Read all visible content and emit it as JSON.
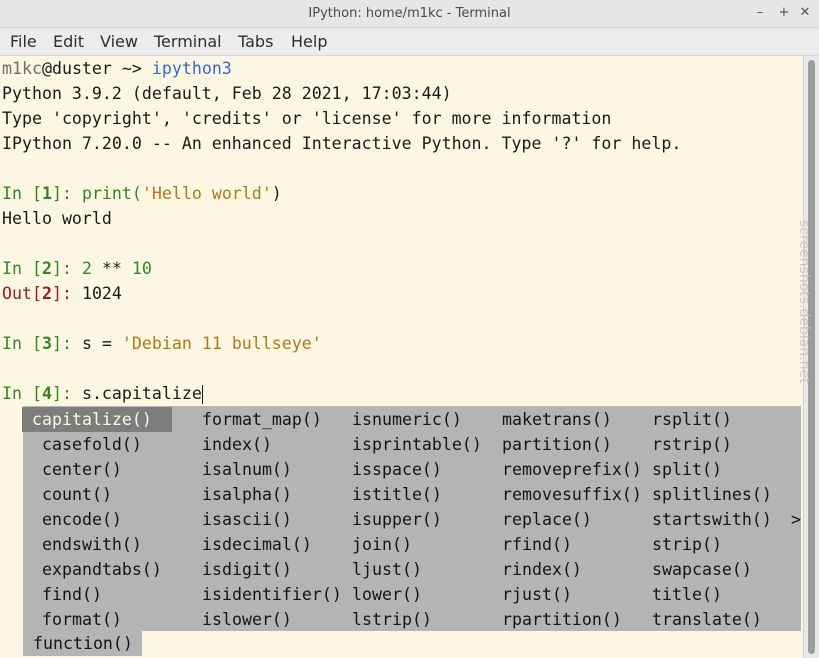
{
  "window": {
    "title": "IPython: home/m1kc - Terminal",
    "min_glyph": "–",
    "max_glyph": "+",
    "close_glyph": "✕"
  },
  "menu": [
    "File",
    "Edit",
    "View",
    "Terminal",
    "Tabs",
    "Help"
  ],
  "terminal": {
    "prompt_user": "m1kc",
    "prompt_host": "@duster ~>",
    "prompt_cmd": "ipython3",
    "banner": [
      "Python 3.9.2 (default, Feb 28 2021, 17:03:44)",
      "Type 'copyright', 'credits' or 'license' for more information",
      "IPython 7.20.0 -- An enhanced Interactive Python. Type '?' for help."
    ],
    "in1_prefix": "In [",
    "in1_num": "1",
    "in1_suffix": "]: ",
    "in1_code_fn": "print(",
    "in1_code_str": "'Hello world'",
    "in1_code_end": ")",
    "out1_text": "Hello world",
    "in2_prefix": "In [",
    "in2_num": "2",
    "in2_suffix": "]: ",
    "in2_a": "2",
    "in2_op": " ** ",
    "in2_b": "10",
    "out2_prefix": "Out[",
    "out2_num": "2",
    "out2_suffix": "]: ",
    "out2_value": "1024",
    "in3_prefix": "In [",
    "in3_num": "3",
    "in3_suffix": "]: ",
    "in3_code": "s = ",
    "in3_str": "'Debian 11 bullseye'",
    "in4_prefix": "In [",
    "in4_num": "4",
    "in4_suffix": "]: ",
    "in4_code": "s.capitalize"
  },
  "completions": {
    "columns": [
      [
        "capitalize()",
        "casefold()",
        "center()",
        "count()",
        "encode()",
        "endswith()",
        "expandtabs()",
        "find()",
        "format()"
      ],
      [
        "format_map()",
        "index()",
        "isalnum()",
        "isalpha()",
        "isascii()",
        "isdecimal()",
        "isdigit()",
        "isidentifier()",
        "islower()"
      ],
      [
        "isnumeric()",
        "isprintable()",
        "isspace()",
        "istitle()",
        "isupper()",
        "join()",
        "ljust()",
        "lower()",
        "lstrip()"
      ],
      [
        "maketrans()",
        "partition()",
        "removeprefix()",
        "removesuffix()",
        "replace()",
        "rfind()",
        "rindex()",
        "rjust()",
        "rpartition()"
      ],
      [
        "rsplit()",
        "rstrip()",
        "split()",
        "splitlines()",
        "startswith()",
        "strip()",
        "swapcase()",
        "title()",
        "translate()"
      ]
    ],
    "selected": "capitalize()",
    "more_indicator": ">",
    "signature": "function()"
  },
  "watermark": "screenshots.debian.net"
}
